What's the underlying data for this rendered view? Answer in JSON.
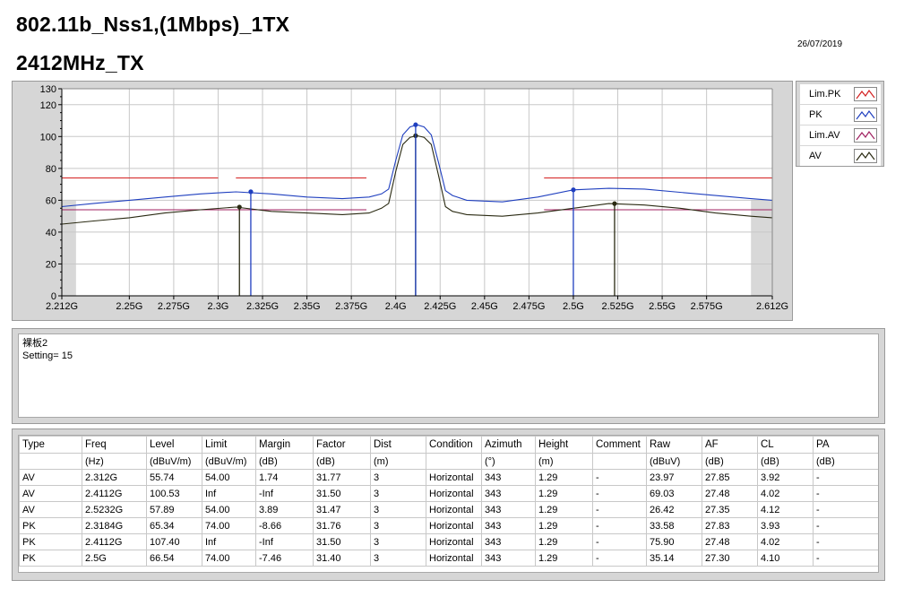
{
  "header": {
    "title_line1": "802.11b_Nss1,(1Mbps)_1TX",
    "title_line2": "2412MHz_TX",
    "date": "26/07/2019"
  },
  "colors": {
    "pk": "#1f3fbf",
    "av": "#2a2a12",
    "limit": "#d42020",
    "limit_av": "#a02060",
    "plot_bg": "#ffffff",
    "plot_out": "#d8d8d8"
  },
  "legend": [
    {
      "label": "Lim.PK",
      "color": "#d42020"
    },
    {
      "label": "PK",
      "color": "#1f3fbf"
    },
    {
      "label": "Lim.AV",
      "color": "#a02060"
    },
    {
      "label": "AV",
      "color": "#2a2a12"
    }
  ],
  "chart_data": {
    "type": "line",
    "xlim": [
      2.212,
      2.612
    ],
    "ylim": [
      0,
      130
    ],
    "x_ticks": [
      2.212,
      2.25,
      2.275,
      2.3,
      2.325,
      2.35,
      2.375,
      2.4,
      2.425,
      2.45,
      2.475,
      2.5,
      2.525,
      2.55,
      2.575,
      2.612
    ],
    "x_tick_labels": [
      "2.212G",
      "2.25G",
      "2.275G",
      "2.3G",
      "2.325G",
      "2.35G",
      "2.375G",
      "2.4G",
      "2.425G",
      "2.45G",
      "2.475G",
      "2.5G",
      "2.525G",
      "2.55G",
      "2.575G",
      "2.612G"
    ],
    "y_ticks": [
      0,
      20,
      40,
      60,
      80,
      100,
      120,
      130
    ],
    "y_tick_labels": [
      "0",
      "20",
      "40",
      "60",
      "80",
      "100",
      "120",
      "130"
    ],
    "limits": [
      {
        "name": "Lim.PK",
        "segments": [
          [
            2.212,
            2.3,
            74
          ],
          [
            2.31,
            2.3835,
            74
          ],
          [
            2.4835,
            2.612,
            74
          ]
        ]
      },
      {
        "name": "Lim.AV",
        "segments": [
          [
            2.212,
            2.3835,
            54
          ],
          [
            2.4835,
            2.612,
            54
          ]
        ]
      }
    ],
    "series": [
      {
        "name": "PK",
        "x": [
          2.212,
          2.23,
          2.25,
          2.27,
          2.29,
          2.31,
          2.33,
          2.35,
          2.37,
          2.385,
          2.392,
          2.396,
          2.4,
          2.404,
          2.408,
          2.412,
          2.416,
          2.42,
          2.424,
          2.428,
          2.432,
          2.44,
          2.46,
          2.48,
          2.5,
          2.52,
          2.54,
          2.56,
          2.58,
          2.6,
          2.612
        ],
        "y": [
          56,
          58,
          60,
          62,
          64,
          65.3,
          64,
          62,
          61,
          62,
          64,
          67,
          85,
          101,
          106,
          107.4,
          106,
          101,
          84,
          66,
          63,
          60,
          59,
          62,
          66.5,
          67.5,
          67,
          65,
          63,
          61,
          60
        ]
      },
      {
        "name": "AV",
        "x": [
          2.212,
          2.23,
          2.25,
          2.27,
          2.29,
          2.31,
          2.33,
          2.35,
          2.37,
          2.385,
          2.392,
          2.396,
          2.4,
          2.404,
          2.408,
          2.412,
          2.416,
          2.42,
          2.424,
          2.428,
          2.432,
          2.44,
          2.46,
          2.48,
          2.5,
          2.52,
          2.54,
          2.56,
          2.58,
          2.6,
          2.612
        ],
        "y": [
          45,
          47,
          49,
          52,
          54,
          55.7,
          53,
          52,
          51,
          52,
          55,
          58,
          78,
          95,
          99.5,
          100.5,
          99.5,
          95,
          76,
          56,
          53,
          51,
          50,
          52,
          55,
          57.9,
          57,
          55,
          52,
          50,
          49
        ]
      }
    ],
    "markers": [
      {
        "series": "AV",
        "x": 2.312,
        "y": 55.74
      },
      {
        "series": "AV",
        "x": 2.4112,
        "y": 100.53
      },
      {
        "series": "AV",
        "x": 2.5232,
        "y": 57.89
      },
      {
        "series": "PK",
        "x": 2.3184,
        "y": 65.34
      },
      {
        "series": "PK",
        "x": 2.4112,
        "y": 107.4
      },
      {
        "series": "PK",
        "x": 2.5,
        "y": 66.54
      }
    ]
  },
  "note": {
    "line1": "裸板2",
    "line2": "Setting= 15"
  },
  "table": {
    "headers": [
      "Type",
      "Freq",
      "Level",
      "Limit",
      "Margin",
      "Factor",
      "Dist",
      "Condition",
      "Azimuth",
      "Height",
      "Comment",
      "Raw",
      "AF",
      "CL",
      "PA"
    ],
    "units": [
      "",
      "(Hz)",
      "(dBuV/m)",
      "(dBuV/m)",
      "(dB)",
      "(dB)",
      "(m)",
      "",
      "(°)",
      "(m)",
      "",
      "(dBuV)",
      "(dB)",
      "(dB)",
      "(dB)"
    ],
    "rows": [
      [
        "AV",
        "2.312G",
        "55.74",
        "54.00",
        "1.74",
        "31.77",
        "3",
        "Horizontal",
        "343",
        "1.29",
        "-",
        "23.97",
        "27.85",
        "3.92",
        "-"
      ],
      [
        "AV",
        "2.4112G",
        "100.53",
        "Inf",
        "-Inf",
        "31.50",
        "3",
        "Horizontal",
        "343",
        "1.29",
        "-",
        "69.03",
        "27.48",
        "4.02",
        "-"
      ],
      [
        "AV",
        "2.5232G",
        "57.89",
        "54.00",
        "3.89",
        "31.47",
        "3",
        "Horizontal",
        "343",
        "1.29",
        "-",
        "26.42",
        "27.35",
        "4.12",
        "-"
      ],
      [
        "PK",
        "2.3184G",
        "65.34",
        "74.00",
        "-8.66",
        "31.76",
        "3",
        "Horizontal",
        "343",
        "1.29",
        "-",
        "33.58",
        "27.83",
        "3.93",
        "-"
      ],
      [
        "PK",
        "2.4112G",
        "107.40",
        "Inf",
        "-Inf",
        "31.50",
        "3",
        "Horizontal",
        "343",
        "1.29",
        "-",
        "75.90",
        "27.48",
        "4.02",
        "-"
      ],
      [
        "PK",
        "2.5G",
        "66.54",
        "74.00",
        "-7.46",
        "31.40",
        "3",
        "Horizontal",
        "343",
        "1.29",
        "-",
        "35.14",
        "27.30",
        "4.10",
        "-"
      ]
    ]
  }
}
